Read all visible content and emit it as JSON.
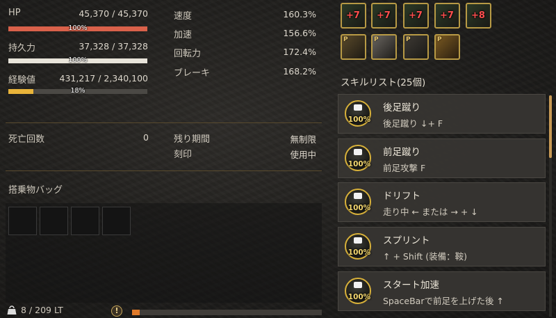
{
  "stats": {
    "hp": {
      "label": "HP",
      "value": "45,370 / 45,370",
      "percent_text": "100%",
      "fraction": 1.0,
      "color": "#d9614a"
    },
    "stamina": {
      "label": "持久力",
      "value": "37,328 / 37,328",
      "percent_text": "100%",
      "fraction": 1.0,
      "color": "#e8e4da"
    },
    "exp": {
      "label": "経験値",
      "value": "431,217 / 2,340,100",
      "percent_text": "18%",
      "fraction": 0.18,
      "color": "#e9b43a"
    }
  },
  "performance": [
    {
      "label": "速度",
      "value": "160.3%"
    },
    {
      "label": "加速",
      "value": "156.6%"
    },
    {
      "label": "回転力",
      "value": "172.4%"
    },
    {
      "label": "ブレーキ",
      "value": "168.2%"
    }
  ],
  "info": {
    "death_label": "死亡回数",
    "death_value": "0",
    "period_label": "残り期間",
    "period_value": "無制限",
    "stamp_label": "刻印",
    "stamp_value": "使用中"
  },
  "bag": {
    "title": "搭乗物バッグ",
    "weight": "8 / 209 LT",
    "warning_icon": "exclamation-icon",
    "weight_fraction": 0.04,
    "weight_color": "#e07a2a"
  },
  "equipment": {
    "row1": [
      {
        "badge": "+7",
        "icon": "reins-icon"
      },
      {
        "badge": "+7",
        "icon": "saddle-icon"
      },
      {
        "badge": "+7",
        "icon": "stirrups-icon"
      },
      {
        "badge": "+7",
        "icon": "horseshoe-icon"
      },
      {
        "badge": "+8",
        "icon": "horseshoe-ring-icon"
      }
    ],
    "row2": [
      {
        "badge": "P",
        "icon": "costume-saddle-icon"
      },
      {
        "badge": "P",
        "icon": "costume-barding-icon"
      },
      {
        "badge": "P",
        "icon": "costume-stirrups-icon"
      },
      {
        "badge": "P",
        "icon": "costume-armor-icon"
      }
    ]
  },
  "skills": {
    "title": "スキルリスト(25個)",
    "items": [
      {
        "name": "後足蹴り",
        "keys": "後足蹴り ↓+ F",
        "level": "100%"
      },
      {
        "name": "前足蹴り",
        "keys": "前足攻撃 F",
        "level": "100%"
      },
      {
        "name": "ドリフト",
        "keys": "走り中 ← または → + ↓",
        "level": "100%"
      },
      {
        "name": "スプリント",
        "keys": "↑ + Shift (装備：鞍)",
        "level": "100%"
      },
      {
        "name": "スタート加速",
        "keys": "SpaceBarで前足を上げた後 ↑",
        "level": "100%"
      }
    ]
  },
  "colors": {
    "accent": "#b89a45",
    "divider": "#5a4b2e"
  }
}
